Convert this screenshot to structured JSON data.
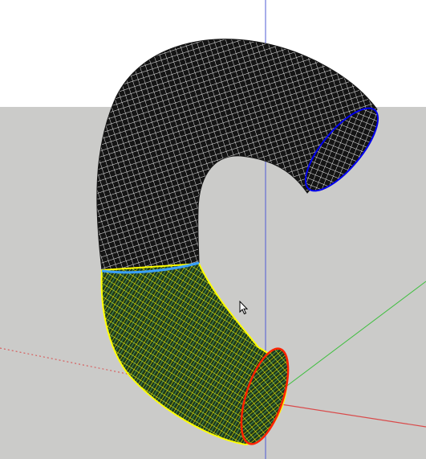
{
  "colors": {
    "sky": "#ffffff",
    "ground": "#cbcbc9",
    "mesh_dark": "#141414",
    "mesh_grid": "#f2f2f2",
    "selected_fill": "#1e3a1c",
    "selected_grid": "#ffff00",
    "selected_grid_minor": "#7fe07f",
    "blue_axis": "#4f5bd5",
    "red_axis": "#d94a4a",
    "green_axis": "#3fbf3f",
    "top_edge": "#0000ee",
    "seam_edge": "#3aa0ff",
    "end_edge": "#ff2200"
  },
  "icons": {
    "cursor": "mouse-pointer-icon"
  }
}
